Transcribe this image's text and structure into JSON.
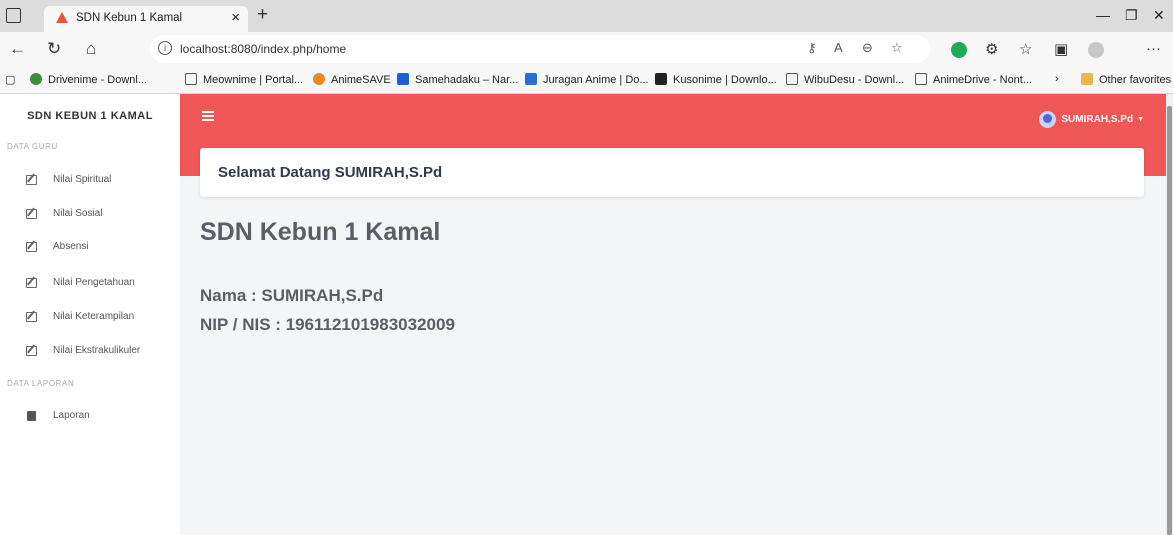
{
  "browser": {
    "tab_title": "SDN Kebun 1 Kamal",
    "tab_close": "×",
    "new_tab": "+",
    "url": "localhost:8080/index.php/home",
    "window_controls": {
      "minimize": "—",
      "restore": "❐",
      "close": "✕"
    },
    "more": "···"
  },
  "bookmarks": [
    {
      "label": "Drivenime - Downl...",
      "icon": "drivenime-icon",
      "color": "#3b8f3b"
    },
    {
      "label": "Meownime | Portal...",
      "icon": "page-icon",
      "color": "#ffffff"
    },
    {
      "label": "AnimeSAVE",
      "icon": "animesave-icon",
      "color": "#e98a1f"
    },
    {
      "label": "Samehadaku – Nar...",
      "icon": "samehadaku-icon",
      "color": "#1f5fd6"
    },
    {
      "label": "Juragan Anime | Do...",
      "icon": "juragan-icon",
      "color": "#2a6fd0"
    },
    {
      "label": "Kusonime | Downlo...",
      "icon": "kusonime-icon",
      "color": "#222222"
    },
    {
      "label": "WibuDesu - Downl...",
      "icon": "page-icon",
      "color": "#ffffff"
    },
    {
      "label": "AnimeDrive - Nont...",
      "icon": "page-icon",
      "color": "#ffffff"
    }
  ],
  "other_favorites": "Other favorites",
  "sidebar": {
    "brand": "SDN KEBUN 1 KAMAL",
    "section_guru": "DATA GURU",
    "items": [
      {
        "label": "Nilai Spiritual"
      },
      {
        "label": "Nilai Sosial"
      },
      {
        "label": "Absensi"
      },
      {
        "label": "Nilai Pengetahuan"
      },
      {
        "label": "Nilai Keterampilan"
      },
      {
        "label": "Nilai Ekstrakulikuler"
      }
    ],
    "section_laporan": "DATA LAPORAN",
    "laporan": "Laporan"
  },
  "topbar": {
    "user_name": "SUMIRAH,S.Pd",
    "accent_color": "#f05656"
  },
  "main": {
    "welcome": "Selamat Datang SUMIRAH,S.Pd",
    "school_name": "SDN Kebun 1 Kamal",
    "nama": "Nama : SUMIRAH,S.Pd",
    "nip": "NIP / NIS : 196112101983032009"
  }
}
